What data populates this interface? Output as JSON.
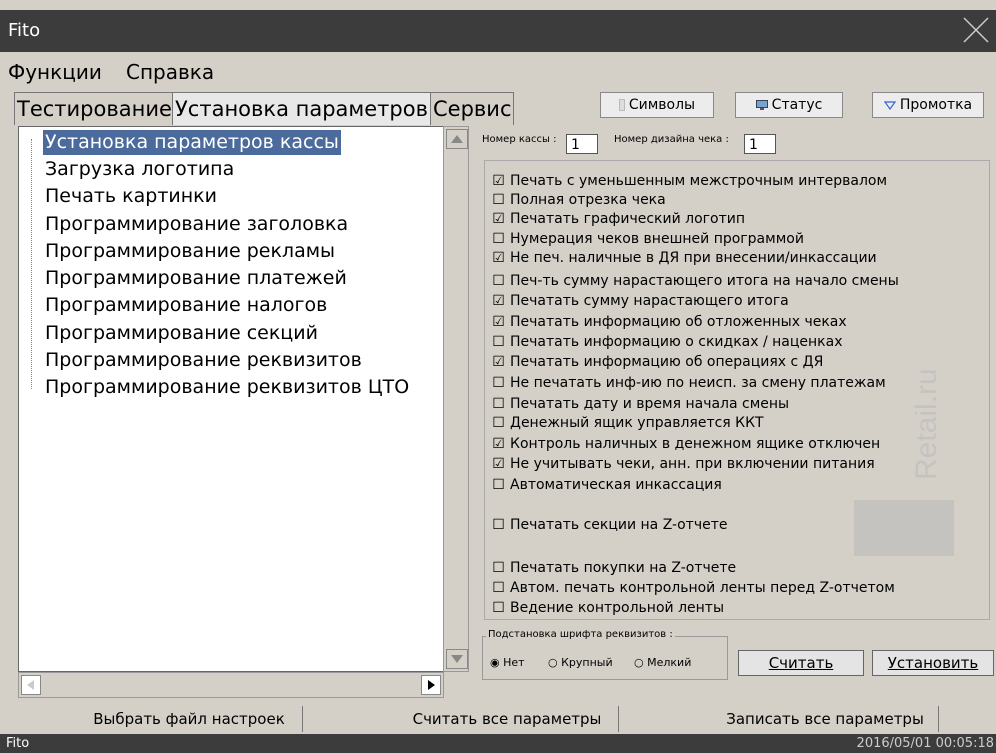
{
  "window": {
    "title": "Fito"
  },
  "menu": {
    "functions": "Функции",
    "help": "Справка"
  },
  "tabs": [
    {
      "label": "Тестирование"
    },
    {
      "label": "Установка параметров"
    },
    {
      "label": "Сервис"
    }
  ],
  "toolbar": {
    "symbols": "Символы",
    "status": "Статус",
    "scroll": "Промотка"
  },
  "tree": [
    "Установка параметров кассы",
    "Загрузка логотипа",
    "Печать картинки",
    "Программирование заголовка",
    "Программирование рекламы",
    "Программирование платежей",
    "Программирование налогов",
    "Программирование секций",
    "Программирование реквизитов",
    "Программирование реквизитов ЦТО"
  ],
  "fields": {
    "cash_label": "Номер кассы :",
    "cash_value": "1",
    "design_label": "Номер дизайна чека :",
    "design_value": "1"
  },
  "options": [
    {
      "label": "Печать с уменьшенным межстрочным интервалом",
      "checked": true
    },
    {
      "label": "Полная отрезка чека",
      "checked": false
    },
    {
      "label": "Печатать графический логотип",
      "checked": true
    },
    {
      "label": "Нумерация чеков внешней программой",
      "checked": false
    },
    {
      "label": "Не печ. наличные в ДЯ при внесении/инкассации",
      "checked": true
    },
    {
      "label": "Печ-ть сумму нарастающего итога на начало смены",
      "checked": false
    },
    {
      "label": "Печатать сумму нарастающего итога",
      "checked": true
    },
    {
      "label": "Печатать информацию об отложенных чеках",
      "checked": true
    },
    {
      "label": "Печатать информацию о скидках / наценках",
      "checked": false
    },
    {
      "label": "Печатать информацию об операциях с ДЯ",
      "checked": true
    },
    {
      "label": "Не печатать инф-ию по неисп. за смену платежам",
      "checked": false
    },
    {
      "label": "Печатать дату и время начала смены",
      "checked": false
    },
    {
      "label": "Денежный ящик управляется ККТ",
      "checked": false
    },
    {
      "label": "Контроль наличных в денежном ящике отключен",
      "checked": true
    },
    {
      "label": "Не учитывать чеки, анн. при включении питания",
      "checked": true
    },
    {
      "label": "Автоматическая инкассация",
      "checked": false
    },
    {
      "label": "Печатать секции на Z-отчете",
      "checked": false
    },
    {
      "label": "Печатать покупки на Z-отчете",
      "checked": false
    },
    {
      "label": "Автом. печать контрольной ленты перед Z-отчетом",
      "checked": false
    },
    {
      "label": "Ведение контрольной ленты",
      "checked": false
    }
  ],
  "font_subst": {
    "title": "Подстановка шрифта реквизитов :",
    "none": "Нет",
    "large": "Крупный",
    "small": "Мелкий",
    "selected": "Нет"
  },
  "actions": {
    "read": "Считать",
    "set": "Установить"
  },
  "bottom": {
    "choose_file": "Выбрать файл настроек",
    "read_all": "Считать все параметры",
    "write_all": "Записать все параметры"
  },
  "status": {
    "left": "Fito",
    "datetime": "2016/05/01 00:05:18"
  },
  "colors": {
    "titlebar": "#3c3c3c",
    "selection": "#4a6b9b",
    "background": "#d4d0c8"
  }
}
